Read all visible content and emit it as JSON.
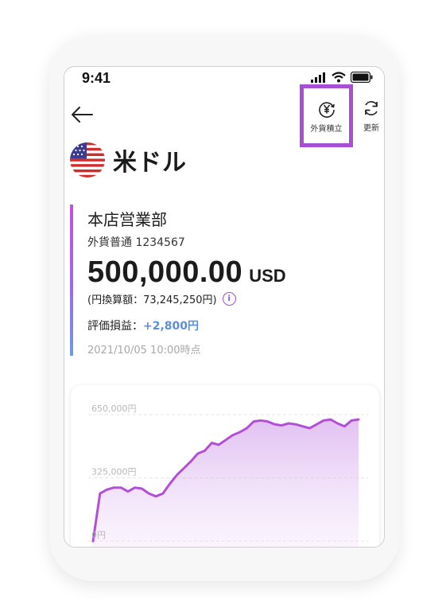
{
  "status_bar": {
    "time": "9:41"
  },
  "header": {
    "tsumitate_label": "外貨積立",
    "refresh_label": "更新"
  },
  "currency": {
    "name": "米ドル",
    "flag_icon": "us-flag-icon"
  },
  "account": {
    "branch": "本店営業部",
    "type_number": "外貨普通 1234567",
    "balance": "500,000.00",
    "unit": "USD",
    "jpy_equiv": "(円換算額：73,245,250円)",
    "pl_label": "評価損益：",
    "pl_value": "+2,800円",
    "as_of": "2021/10/05 10:00時点"
  },
  "colors": {
    "accent": "#a94fd1",
    "positive": "#5a8fe0",
    "line": "#b24fd8"
  },
  "chart_data": {
    "type": "area",
    "yticks": [
      "650,000円",
      "325,000円",
      "0円"
    ],
    "ylim": [
      0,
      650000
    ],
    "y": [
      0,
      245000,
      265000,
      275000,
      275000,
      255000,
      275000,
      270000,
      245000,
      230000,
      245000,
      295000,
      340000,
      375000,
      410000,
      450000,
      465000,
      505000,
      495000,
      520000,
      545000,
      560000,
      580000,
      615000,
      620000,
      615000,
      600000,
      595000,
      605000,
      600000,
      590000,
      580000,
      600000,
      620000,
      625000,
      605000,
      590000,
      620000,
      625000
    ]
  }
}
